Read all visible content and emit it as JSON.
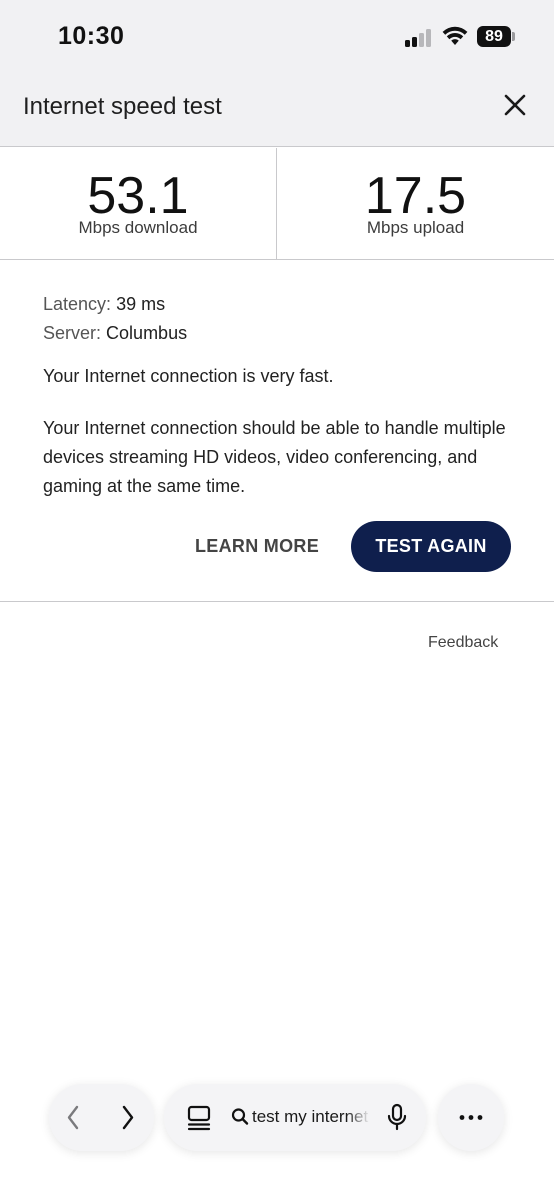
{
  "status_bar": {
    "time": "10:30",
    "battery": "89"
  },
  "header": {
    "title": "Internet speed test",
    "close_icon": "close-icon"
  },
  "results": {
    "download": {
      "value": "53.1",
      "unit": "Mbps download"
    },
    "upload": {
      "value": "17.5",
      "unit": "Mbps upload"
    }
  },
  "details": {
    "latency_label": "Latency:",
    "latency_value": "39 ms",
    "server_label": "Server:",
    "server_value": "Columbus"
  },
  "message": {
    "summary": "Your Internet connection is very fast.",
    "detail": "Your Internet connection should be able to handle multiple devices streaming HD videos, video conferencing, and gaming at the same time."
  },
  "actions": {
    "learn_more": "LEARN MORE",
    "test_again": "TEST AGAIN"
  },
  "feedback": "Feedback",
  "toolbar": {
    "search_query": "test my internet speed",
    "icons": [
      "back-icon",
      "forward-icon",
      "tabs-icon",
      "search-icon",
      "microphone-icon",
      "more-icon"
    ]
  },
  "colors": {
    "primary_button": "#0f1f4d",
    "header_bg": "#f1f1f3"
  }
}
